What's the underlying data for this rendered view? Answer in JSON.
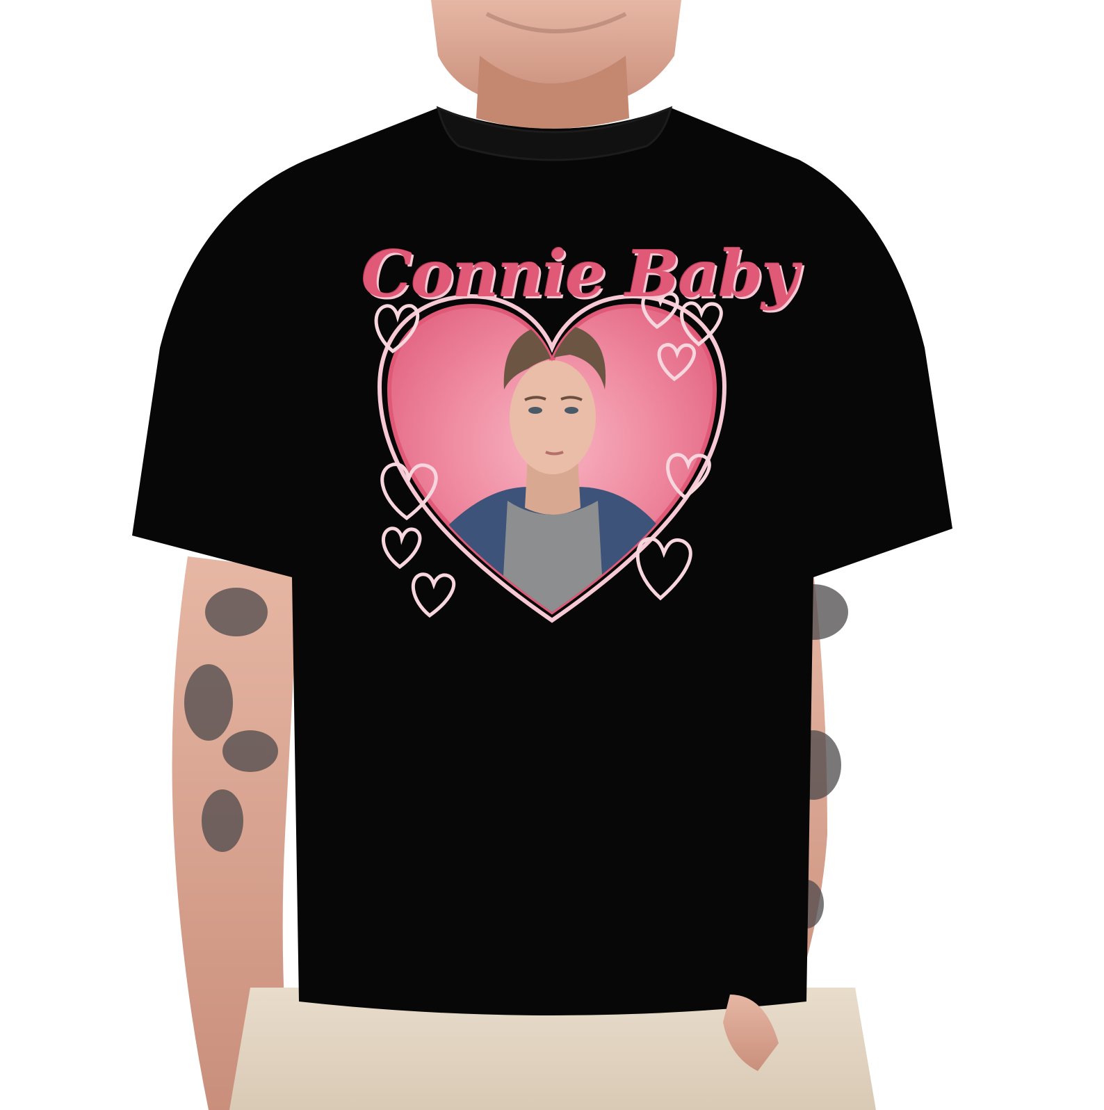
{
  "product_photo": {
    "shirt_color": "#070707",
    "print": {
      "title": "Connie Baby",
      "accent_color": "#e05a78",
      "heart_color": "#f28aa0",
      "outline_color": "#f7c9d4"
    },
    "icons": [
      "heart-icon"
    ]
  }
}
